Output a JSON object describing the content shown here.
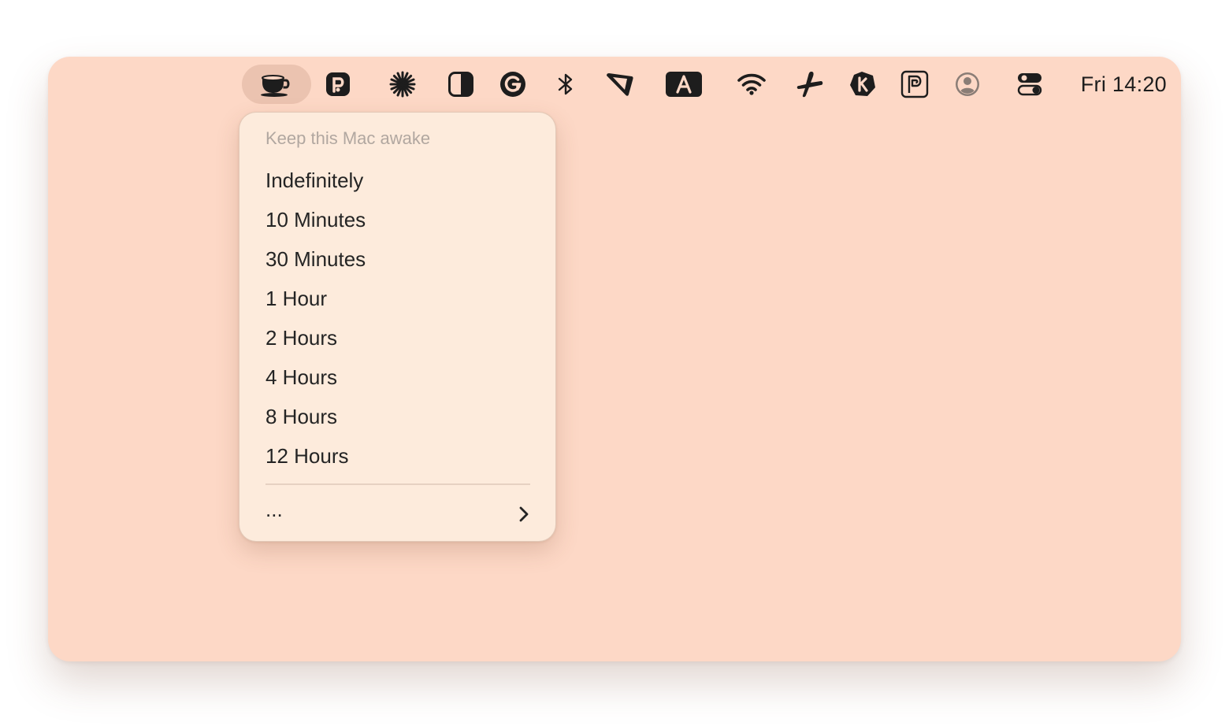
{
  "colors": {
    "window_bg": "#fdd8c6",
    "menu_bg": "#fdebdc",
    "text": "#242424",
    "header_text": "#b1a7a0"
  },
  "menubar": {
    "icons": [
      "coffee-cup-icon",
      "p-badge-icon",
      "asterisk-burst-icon",
      "half-square-icon",
      "g-circle-icon",
      "bluetooth-icon",
      "flag-cut-icon",
      "a-keyboard-icon",
      "wifi-icon",
      "plane-icon",
      "k-badge-icon",
      "p-outline-icon",
      "user-circle-icon",
      "control-center-icon"
    ],
    "clock": "Fri 14:20"
  },
  "menu": {
    "header": "Keep this Mac awake",
    "items": [
      "Indefinitely",
      "10 Minutes",
      "30 Minutes",
      "1 Hour",
      "2 Hours",
      "4 Hours",
      "8 Hours",
      "12 Hours"
    ],
    "more_label": "...",
    "more_icon": "chevron-right-icon"
  }
}
